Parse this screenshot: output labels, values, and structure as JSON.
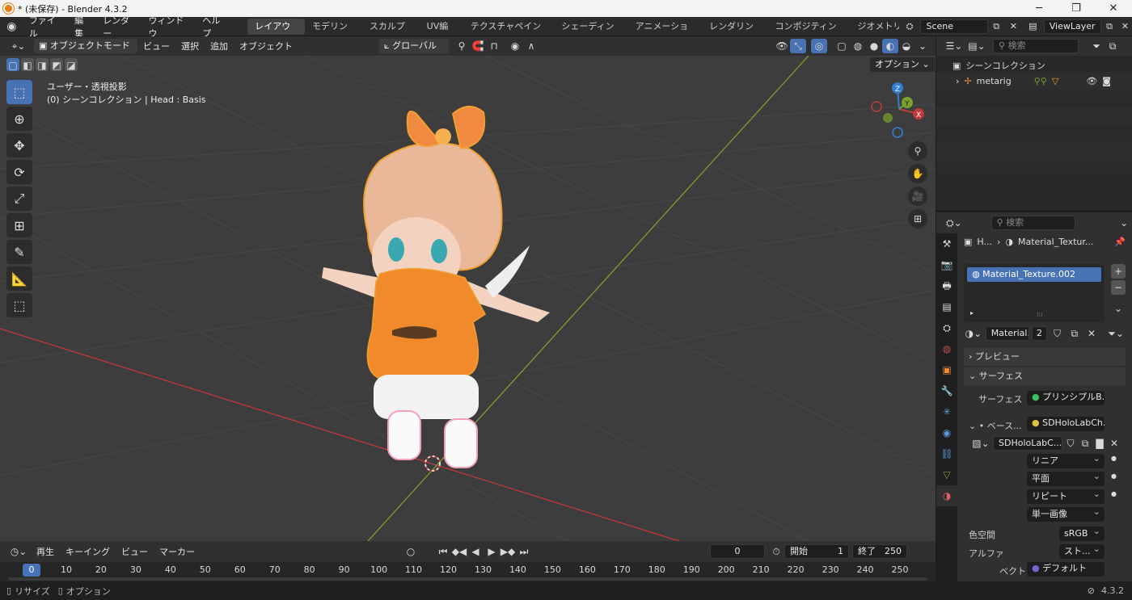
{
  "window": {
    "title": "* (未保存) - Blender 4.3.2",
    "minimize": "─",
    "maximize": "❐",
    "close": "✕"
  },
  "menu": {
    "items": [
      "ファイル",
      "編集",
      "レンダー",
      "ウィンドウ",
      "ヘルプ"
    ]
  },
  "workspaces": {
    "tabs": [
      "レイアウト",
      "モデリング",
      "スカルプト",
      "UV編集",
      "テクスチャペイント",
      "シェーディング",
      "アニメーション",
      "レンダリング",
      "コンポジティング",
      "ジオメトリノ"
    ],
    "active": "レイアウト"
  },
  "scene": {
    "name": "Scene",
    "viewlayer": "ViewLayer"
  },
  "viewport_header": {
    "mode": "オブジェクトモード",
    "menus": [
      "ビュー",
      "選択",
      "追加",
      "オブジェクト"
    ],
    "transform": "グローバル",
    "options": "オプション"
  },
  "viewport": {
    "view_name": "ユーザー・透視投影",
    "collection_info": "(0) シーンコレクション | Head : Basis"
  },
  "timeline": {
    "playback": "再生",
    "keying": "キーイング",
    "view": "ビュー",
    "marker": "マーカー",
    "current_frame": "0",
    "start_label": "開始",
    "start": "1",
    "end_label": "終了",
    "end": "250",
    "ticks": [
      "0",
      "10",
      "20",
      "30",
      "40",
      "50",
      "60",
      "70",
      "80",
      "90",
      "100",
      "110",
      "120",
      "130",
      "140",
      "150",
      "160",
      "170",
      "180",
      "190",
      "200",
      "210",
      "220",
      "230",
      "240",
      "250"
    ]
  },
  "outliner": {
    "search_placeholder": "検索",
    "root": "シーンコレクション",
    "items": [
      {
        "name": "metarig"
      }
    ]
  },
  "properties": {
    "search_placeholder": "検索",
    "breadcrumb_obj": "H...",
    "breadcrumb_mat": "Material_Textur...",
    "slots": [
      "Material_Texture.002"
    ],
    "material_name": "Material...",
    "user_count": "2",
    "panels": {
      "preview": "プレビュー",
      "surface": "サーフェス"
    },
    "surface_label": "サーフェス",
    "surface_value": "プリンシプルB...",
    "base_label": "ベース...",
    "base_value": "SDHoloLabCh...",
    "image_name": "SDHoloLabC...",
    "interp": "リニア",
    "projection": "平面",
    "extension": "リピート",
    "source": "単一画像",
    "colorspace_label": "色空間",
    "colorspace": "sRGB",
    "alpha_label": "アルファ",
    "alpha": "スト...",
    "vector_label": "ベクトル",
    "vector": "デフォルト"
  },
  "status": {
    "left": "リサイズ",
    "options": "オプション",
    "version": "4.3.2"
  },
  "colors": {
    "accent": "#4772b3",
    "selection_outline": "#f0a030",
    "x_axis": "#c0393b",
    "y_axis": "#7aa12e",
    "z_axis": "#2f7fd6"
  }
}
